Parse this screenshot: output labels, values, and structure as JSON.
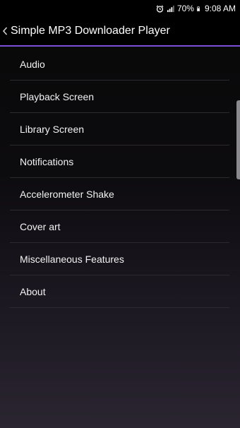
{
  "status_bar": {
    "battery": "70%",
    "time": "9:08 AM",
    "icons": [
      "alarm-icon",
      "signal-icon",
      "battery-icon"
    ]
  },
  "app_bar": {
    "title": "Simple MP3 Downloader Player",
    "back_icon": "chevron-left-icon",
    "accent_color": "#7b4fd6"
  },
  "menu": {
    "items": [
      {
        "label": "Audio"
      },
      {
        "label": "Playback Screen"
      },
      {
        "label": "Library Screen"
      },
      {
        "label": "Notifications"
      },
      {
        "label": "Accelerometer Shake"
      },
      {
        "label": "Cover art"
      },
      {
        "label": "Miscellaneous Features"
      },
      {
        "label": "About"
      }
    ]
  }
}
